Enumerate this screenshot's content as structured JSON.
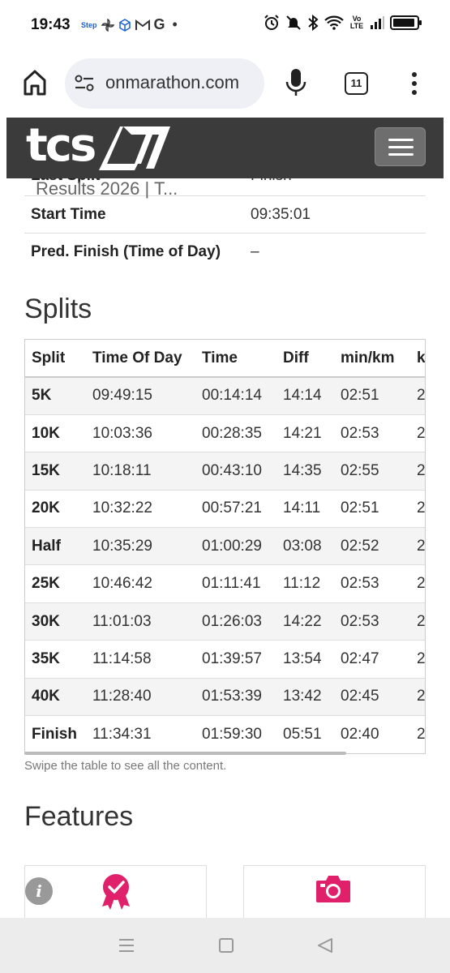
{
  "status_bar": {
    "time": "19:43",
    "left_icons": [
      "step-icon",
      "pinwheel-icon",
      "cube-icon",
      "gmail-icon",
      "google-icon",
      "dot-icon"
    ],
    "right_icons": [
      "alarm-icon",
      "mute-icon",
      "bluetooth-icon",
      "wifi-icon",
      "volte-icon",
      "signal-icon",
      "battery-icon"
    ],
    "volte_label": "Vo LTE"
  },
  "browser": {
    "url": "onmarathon.com",
    "tab_count": "11"
  },
  "site": {
    "logo_text": "tcs",
    "menu_icon": "hamburger-icon"
  },
  "result": {
    "ghost_title": "Results 2026 | T...",
    "rows": [
      {
        "label": "Last Split",
        "value": "Finish"
      },
      {
        "label": "Start Time",
        "value": "09:35:01"
      },
      {
        "label": "Pred. Finish (Time of Day)",
        "value": "–"
      }
    ]
  },
  "splits": {
    "heading": "Splits",
    "columns": [
      "Split",
      "Time Of Day",
      "Time",
      "Diff",
      "min/km",
      "k"
    ],
    "rows": [
      [
        "5K",
        "09:49:15",
        "00:14:14",
        "14:14",
        "02:51",
        "2"
      ],
      [
        "10K",
        "10:03:36",
        "00:28:35",
        "14:21",
        "02:53",
        "2"
      ],
      [
        "15K",
        "10:18:11",
        "00:43:10",
        "14:35",
        "02:55",
        "2"
      ],
      [
        "20K",
        "10:32:22",
        "00:57:21",
        "14:11",
        "02:51",
        "2"
      ],
      [
        "Half",
        "10:35:29",
        "01:00:29",
        "03:08",
        "02:52",
        "2"
      ],
      [
        "25K",
        "10:46:42",
        "01:11:41",
        "11:12",
        "02:53",
        "2"
      ],
      [
        "30K",
        "11:01:03",
        "01:26:03",
        "14:22",
        "02:53",
        "2"
      ],
      [
        "35K",
        "11:14:58",
        "01:39:57",
        "13:54",
        "02:47",
        "2"
      ],
      [
        "40K",
        "11:28:40",
        "01:53:39",
        "13:42",
        "02:45",
        "2"
      ],
      [
        "Finish",
        "11:34:31",
        "01:59:30",
        "05:51",
        "02:40",
        "2"
      ]
    ],
    "swipe_note": "Swipe the table to see all the content."
  },
  "features": {
    "heading": "Features",
    "info_glyph": "i",
    "cards": [
      {
        "icon": "award-ribbon-icon"
      },
      {
        "icon": "camera-icon"
      }
    ]
  },
  "colors": {
    "header_bg": "#3b3b3b",
    "accent_pink": "#e0206b",
    "url_bg": "#eef0f5"
  }
}
